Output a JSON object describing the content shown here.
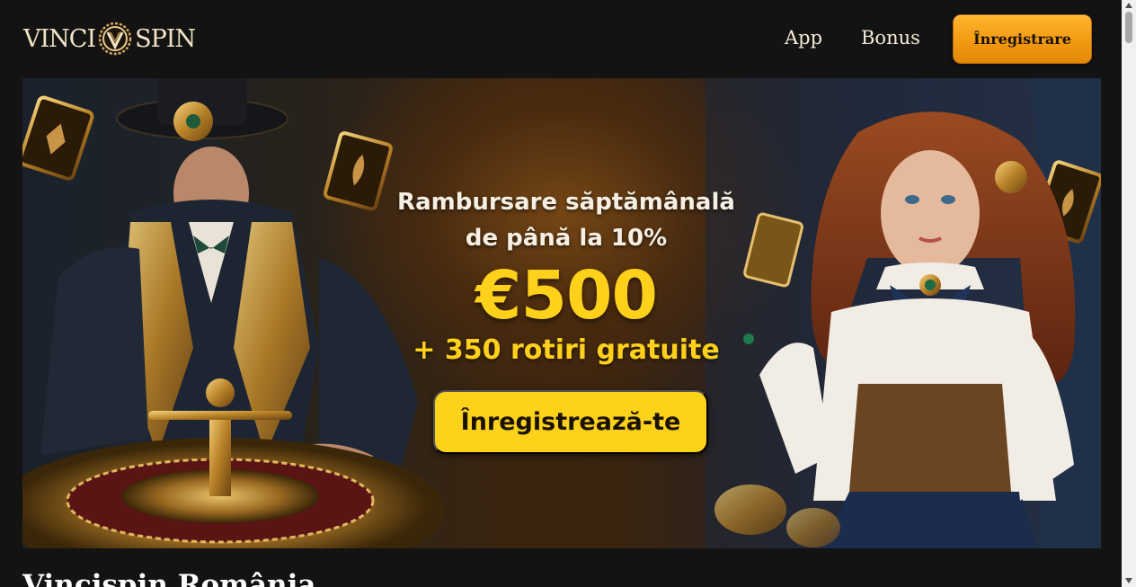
{
  "header": {
    "logo_left": "VINCI",
    "logo_right": "SPIN",
    "nav": [
      {
        "label": "App"
      },
      {
        "label": "Bonus"
      }
    ],
    "register_label": "Înregistrare"
  },
  "banner": {
    "line1": "Rambursare săptămânală",
    "line2": "de până la 10%",
    "amount": "€500",
    "spins": "+ 350 rotiri gratuite",
    "cta_label": "Înregistrează-te"
  },
  "page": {
    "title": "Vincispin România"
  },
  "colors": {
    "background": "#131313",
    "accent_orange": "#f29a12",
    "accent_yellow": "#ffd11a",
    "cta_yellow": "#fdd21b",
    "text_light": "#f3ead8"
  },
  "icons": [
    "logo-emblem-icon",
    "scroll-up-icon",
    "scroll-down-icon"
  ]
}
